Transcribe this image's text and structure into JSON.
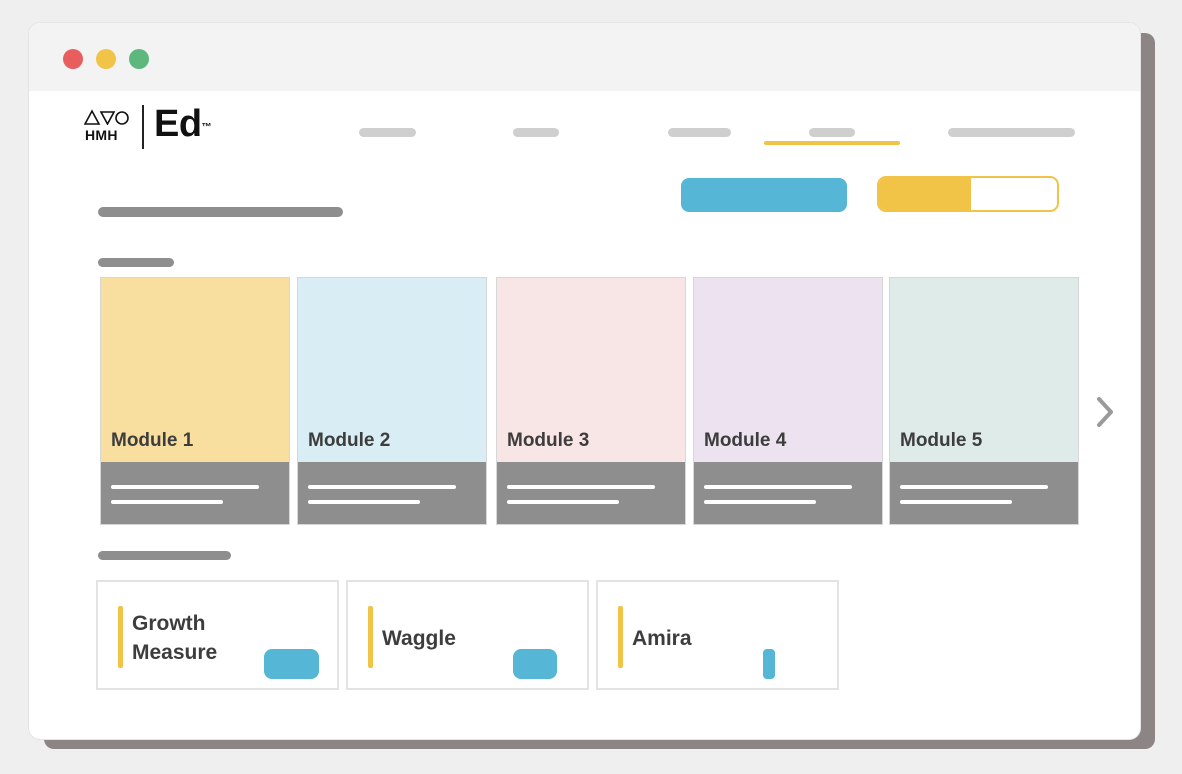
{
  "window": {
    "controls": [
      "close",
      "minimize",
      "maximize"
    ],
    "control_colors": {
      "close": "#e85d5d",
      "minimize": "#f1c346",
      "maximize": "#5db87e"
    }
  },
  "header": {
    "logo": {
      "brand": "HMH",
      "product": "Ed",
      "trademark": "™"
    },
    "nav_items": [
      "nav-placeholder",
      "nav-placeholder",
      "nav-placeholder",
      "nav-placeholder",
      "nav-placeholder"
    ],
    "active_nav_index": 3
  },
  "modules": [
    {
      "label": "Module 1",
      "color": "#f8df9f"
    },
    {
      "label": "Module 2",
      "color": "#d8eef4"
    },
    {
      "label": "Module 3",
      "color": "#f8e6e6"
    },
    {
      "label": "Module 4",
      "color": "#ede2ef"
    },
    {
      "label": "Module 5",
      "color": "#dfebe8"
    }
  ],
  "apps": [
    {
      "name_line1": "Growth",
      "name_line2": "Measure"
    },
    {
      "name_line1": "Waggle",
      "name_line2": ""
    },
    {
      "name_line1": "Amira",
      "name_line2": ""
    }
  ],
  "colors": {
    "accent_yellow": "#f1c346",
    "accent_blue": "#56b6d6",
    "placeholder_gray": "#8e8e8e"
  },
  "icons": [
    "chevron-right-icon"
  ]
}
